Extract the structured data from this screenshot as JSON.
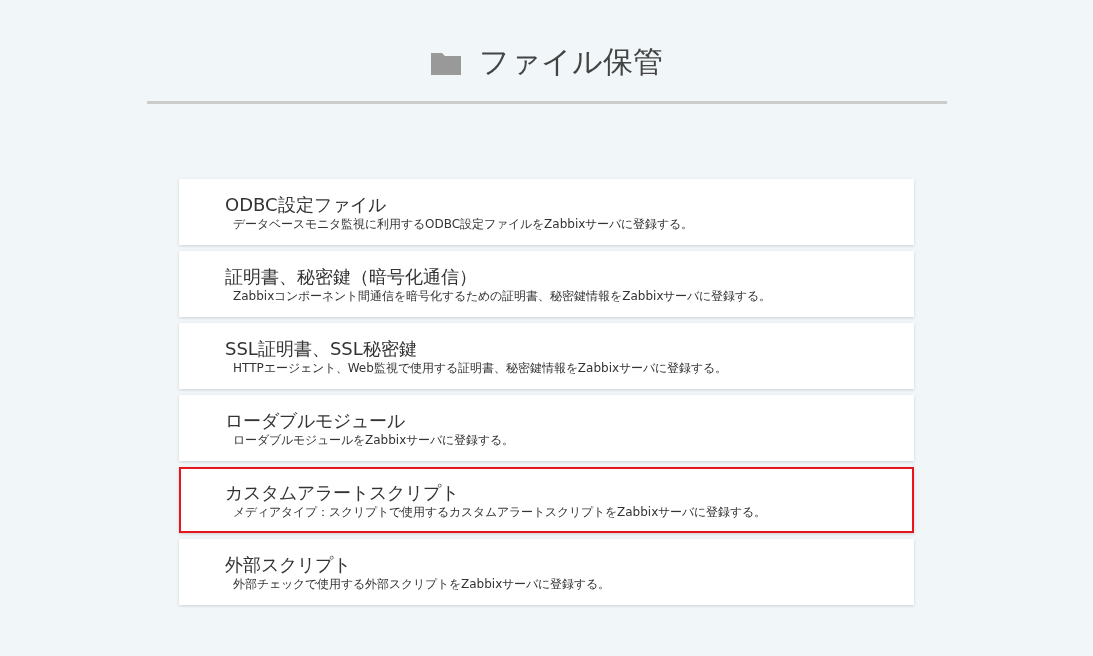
{
  "header": {
    "title": "ファイル保管"
  },
  "items": [
    {
      "title": "ODBC設定ファイル",
      "description": "データベースモニタ監視に利用するODBC設定ファイルをZabbixサーバに登録する。",
      "highlighted": false
    },
    {
      "title": "証明書、秘密鍵（暗号化通信）",
      "description": "Zabbixコンポーネント間通信を暗号化するための証明書、秘密鍵情報をZabbixサーバに登録する。",
      "highlighted": false
    },
    {
      "title": "SSL証明書、SSL秘密鍵",
      "description": "HTTPエージェント、Web監視で使用する証明書、秘密鍵情報をZabbixサーバに登録する。",
      "highlighted": false
    },
    {
      "title": "ローダブルモジュール",
      "description": "ローダブルモジュールをZabbixサーバに登録する。",
      "highlighted": false
    },
    {
      "title": "カスタムアラートスクリプト",
      "description": "メディアタイプ：スクリプトで使用するカスタムアラートスクリプトをZabbixサーバに登録する。",
      "highlighted": true
    },
    {
      "title": "外部スクリプト",
      "description": "外部チェックで使用する外部スクリプトをZabbixサーバに登録する。",
      "highlighted": false
    }
  ]
}
